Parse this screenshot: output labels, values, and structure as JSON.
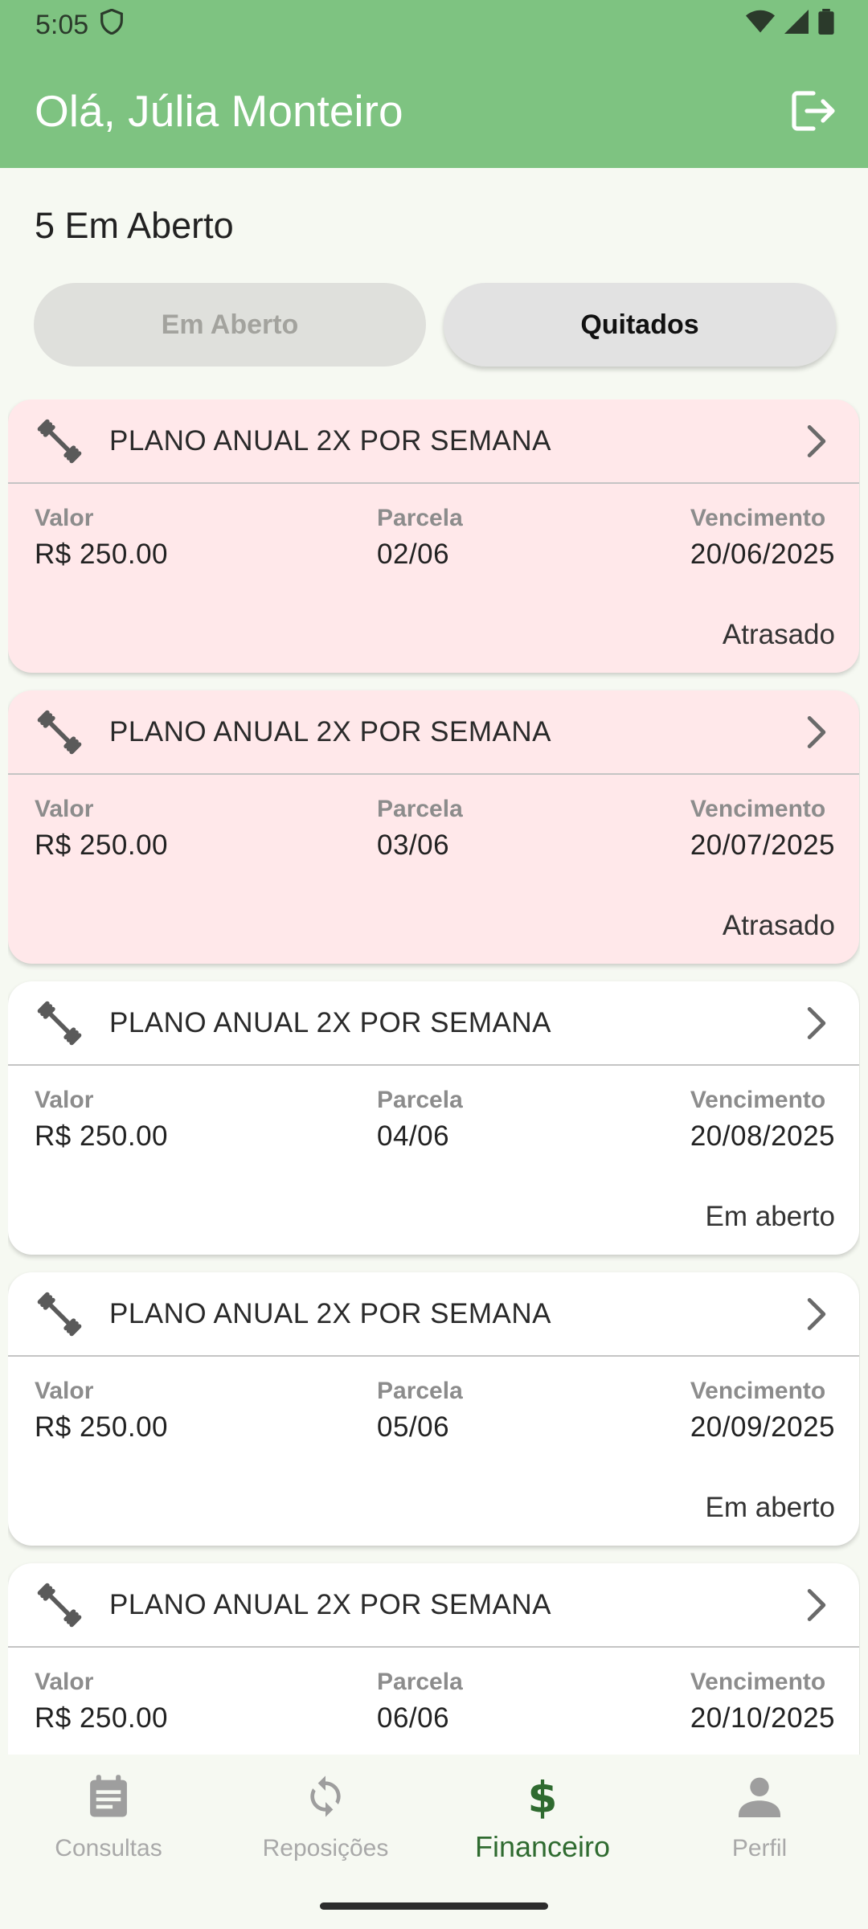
{
  "status_bar": {
    "time": "5:05"
  },
  "header": {
    "greeting": "Olá, Júlia Monteiro"
  },
  "summary": {
    "text": "5 Em Aberto"
  },
  "filter_tabs": [
    {
      "label": "Em Aberto"
    },
    {
      "label": "Quitados"
    }
  ],
  "labels": {
    "valor": "Valor",
    "parcela": "Parcela",
    "vencimento": "Vencimento"
  },
  "cards": [
    {
      "plan": "PLANO ANUAL 2X  POR SEMANA",
      "valor": "R$ 250.00",
      "parcela": "02/06",
      "vencimento": "20/06/2025",
      "status": "Atrasado"
    },
    {
      "plan": "PLANO ANUAL 2X  POR SEMANA",
      "valor": "R$ 250.00",
      "parcela": "03/06",
      "vencimento": "20/07/2025",
      "status": "Atrasado"
    },
    {
      "plan": "PLANO ANUAL 2X  POR SEMANA",
      "valor": "R$ 250.00",
      "parcela": "04/06",
      "vencimento": "20/08/2025",
      "status": "Em aberto"
    },
    {
      "plan": "PLANO ANUAL 2X  POR SEMANA",
      "valor": "R$ 250.00",
      "parcela": "05/06",
      "vencimento": "20/09/2025",
      "status": "Em aberto"
    },
    {
      "plan": "PLANO ANUAL 2X  POR SEMANA",
      "valor": "R$ 250.00",
      "parcela": "06/06",
      "vencimento": "20/10/2025",
      "status": ""
    }
  ],
  "bottom_nav": [
    {
      "label": "Consultas",
      "icon": "calendar-icon"
    },
    {
      "label": "Reposições",
      "icon": "refresh-icon"
    },
    {
      "label": "Financeiro",
      "icon": "dollar-icon"
    },
    {
      "label": "Perfil",
      "icon": "person-icon"
    }
  ],
  "colors": {
    "header": "#7ec381",
    "overdue_card": "#ffe8ea",
    "active_nav": "#2f6b30"
  }
}
